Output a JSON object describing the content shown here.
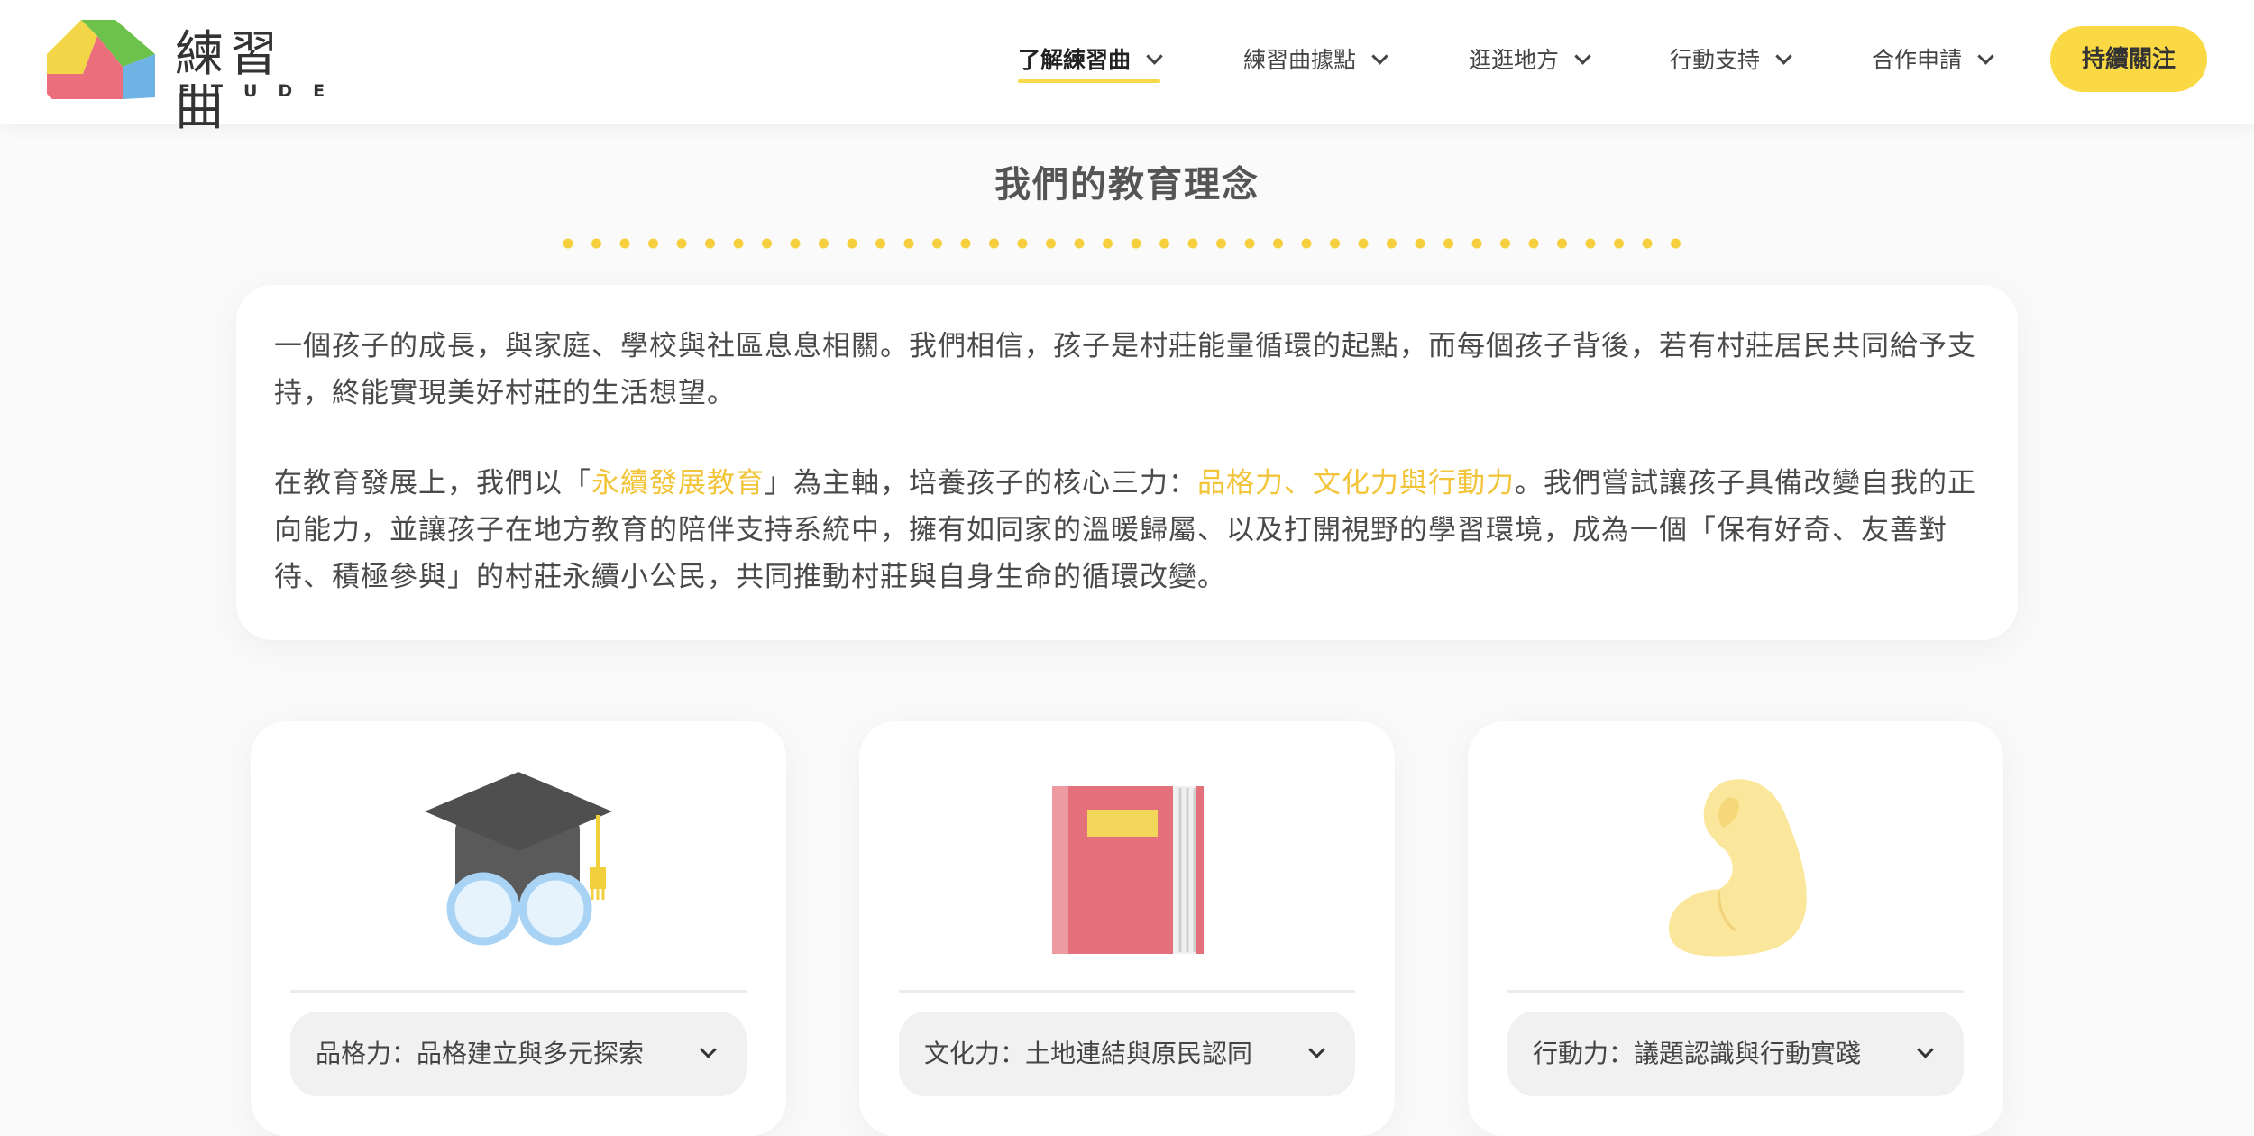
{
  "brand": {
    "name_cn": "練習曲",
    "name_en": "ETUDE"
  },
  "nav": {
    "items": [
      {
        "label": "了解練習曲",
        "active": true
      },
      {
        "label": "練習曲據點",
        "active": false
      },
      {
        "label": "逛逛地方",
        "active": false
      },
      {
        "label": "行動支持",
        "active": false
      },
      {
        "label": "合作申請",
        "active": false
      }
    ],
    "cta_label": "持續關注"
  },
  "section": {
    "title": "我們的教育理念"
  },
  "intro": {
    "p1": "一個孩子的成長，與家庭、學校與社區息息相關。我們相信，孩子是村莊能量循環的起點，而每個孩子背後，若有村莊居民共同給予支持，終能實現美好村莊的生活想望。",
    "p2_before": "在教育發展上，我們以「",
    "p2_hl1": "永續發展教育",
    "p2_mid": "」為主軸，培養孩子的核心三力：",
    "p2_hl2": "品格力、文化力與行動力",
    "p2_after": "。我們嘗試讓孩子具備改變自我的正向能力，並讓孩子在地方教育的陪伴支持系統中，擁有如同家的溫暖歸屬、以及打開視野的學習環境，成為一個「保有好奇、友善對待、積極參與」的村莊永續小公民，共同推動村莊與自身生命的循環改變。"
  },
  "cards": [
    {
      "icon": "graduation-cap-glasses-icon",
      "label": "品格力：品格建立與多元探索"
    },
    {
      "icon": "book-icon",
      "label": "文化力：土地連結與原民認同"
    },
    {
      "icon": "flexed-arm-icon",
      "label": "行動力：議題認識與行動實踐"
    }
  ],
  "colors": {
    "accent": "#fbd944",
    "highlight_text": "#f2c43a",
    "card_bg": "#ffffff",
    "page_bg": "#fafafa"
  }
}
